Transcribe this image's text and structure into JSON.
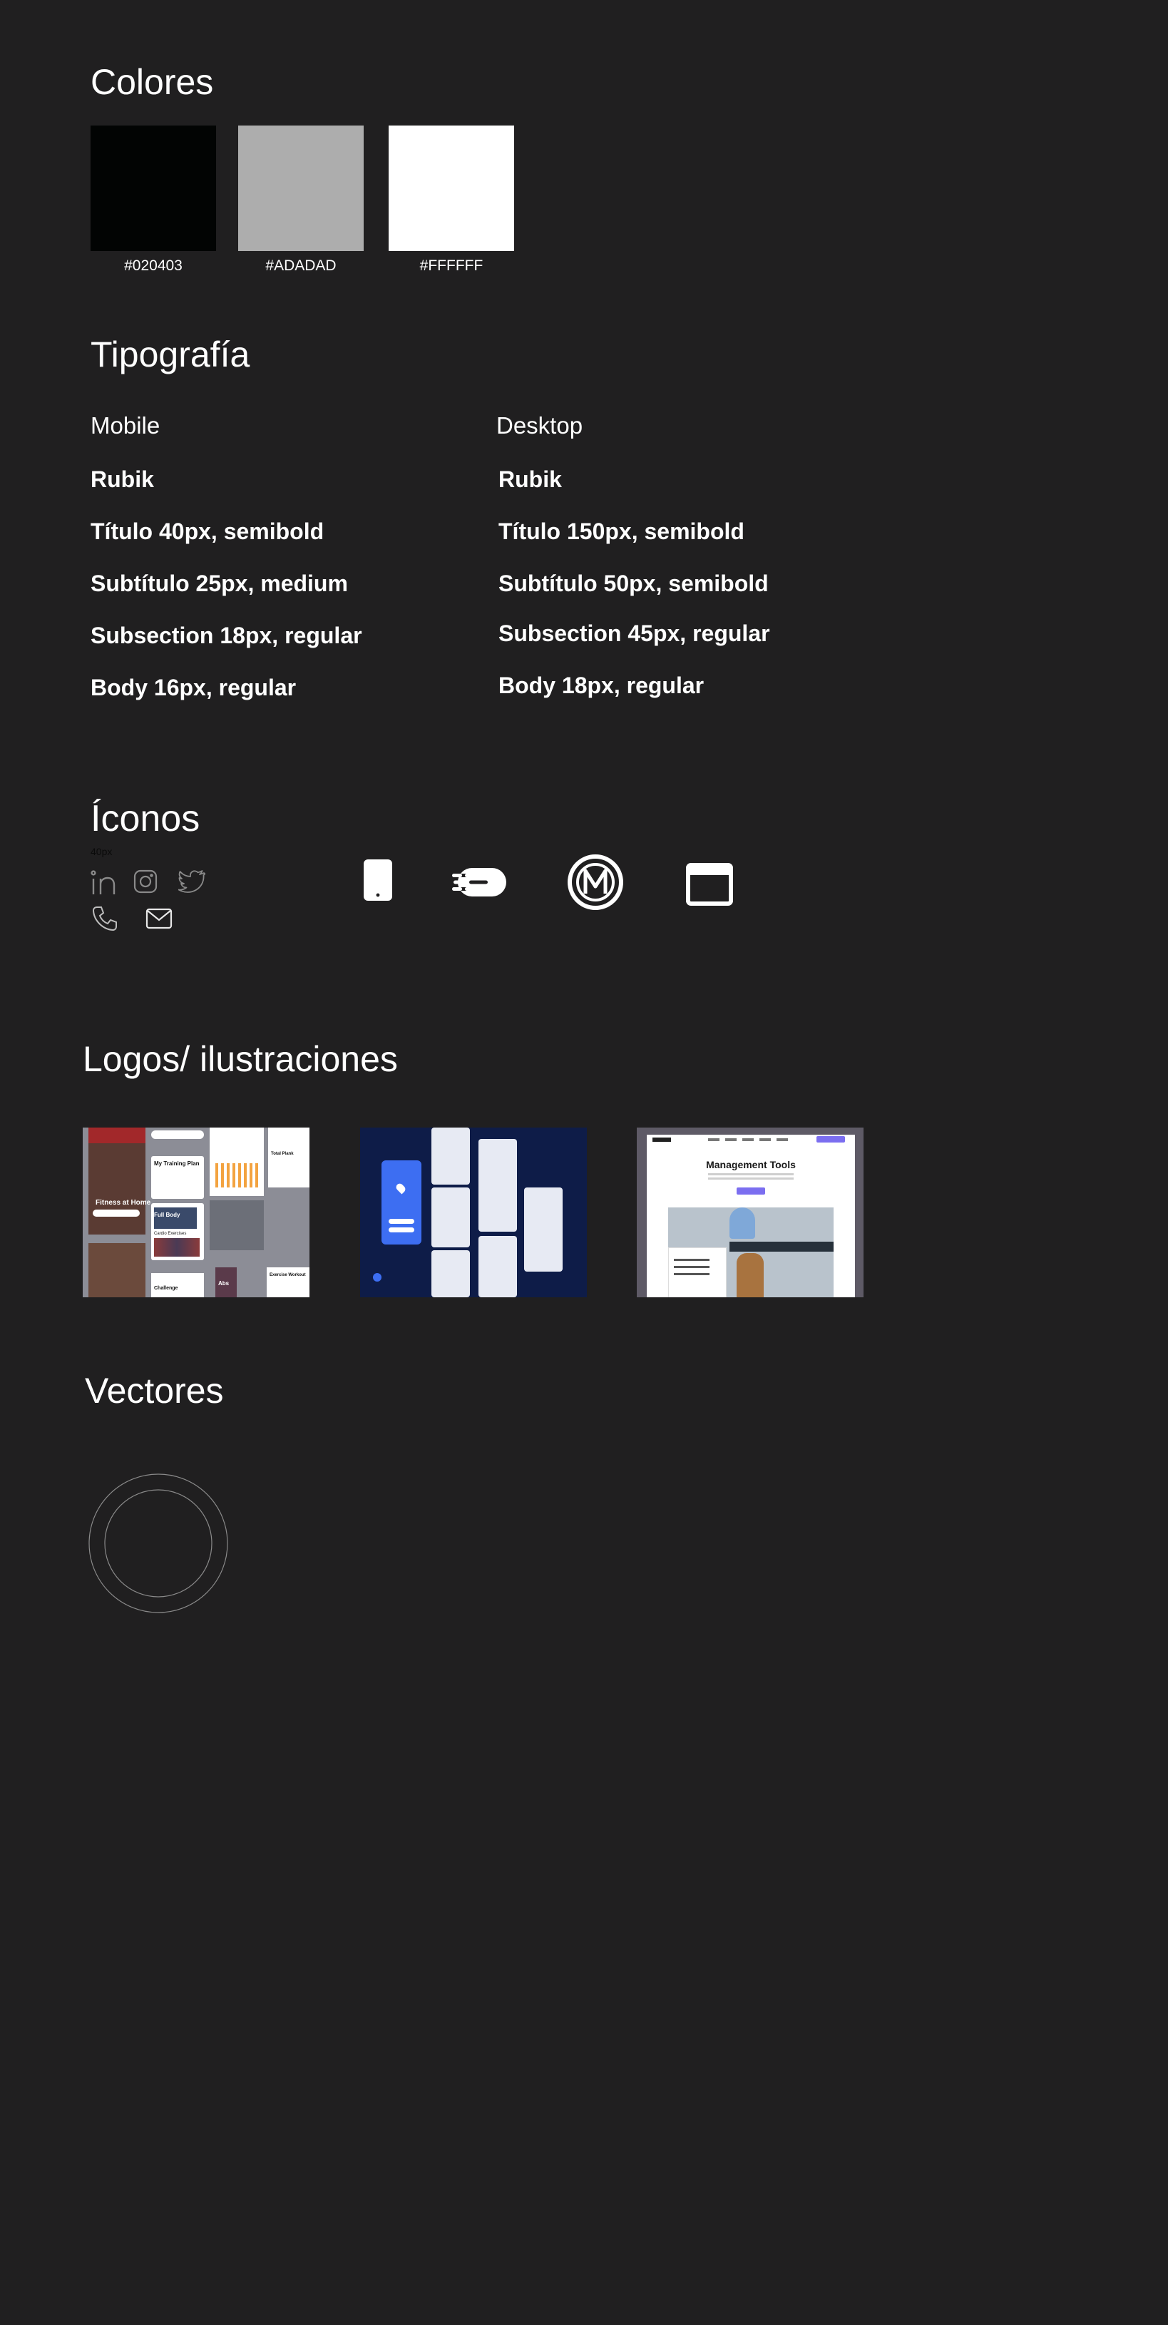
{
  "colores": {
    "title": "Colores",
    "swatches": [
      {
        "hex": "#020403",
        "label": "#020403"
      },
      {
        "hex": "#ADADAD",
        "label": "#ADADAD"
      },
      {
        "hex": "#FFFFFF",
        "label": "#FFFFFF"
      }
    ]
  },
  "tipografia": {
    "title": "Tipografía",
    "mobile": {
      "heading": "Mobile",
      "items": [
        "Rubik",
        "Título 40px, semibold",
        "Subtítulo 25px, medium",
        "Subsection 18px, regular",
        "Body 16px, regular"
      ]
    },
    "desktop": {
      "heading": "Desktop",
      "items": [
        "Rubik",
        "Título 150px, semibold",
        "Subtítulo 50px, semibold",
        "Subsection 45px, regular",
        "Body 18px, regular"
      ]
    }
  },
  "iconos": {
    "title": "Íconos",
    "size_caption": "40px",
    "icons": [
      "linkedin-icon",
      "instagram-icon",
      "twitter-icon",
      "phone-icon",
      "mail-icon",
      "mobile-device-icon",
      "speed-icon",
      "m-logo-icon",
      "browser-window-icon"
    ]
  },
  "logos": {
    "title": "Logos/ ilustraciones",
    "items": [
      {
        "name": "fitness-app-collage",
        "texts": [
          "Fitness at Home",
          "My Training Plan",
          "Full Body",
          "Cardio Exercises",
          "Challenge",
          "Abs",
          "Total Plank",
          "Exercise Workout"
        ]
      },
      {
        "name": "mobile-app-screens",
        "texts": []
      },
      {
        "name": "management-tools-website",
        "texts": [
          "Management Tools"
        ]
      }
    ]
  },
  "vectores": {
    "title": "Vectores"
  },
  "colors": {
    "background": "#201f20",
    "accent_blue": "#3d6ef2",
    "dark_navy": "#0e1c48",
    "purple": "#7b6ef0"
  }
}
